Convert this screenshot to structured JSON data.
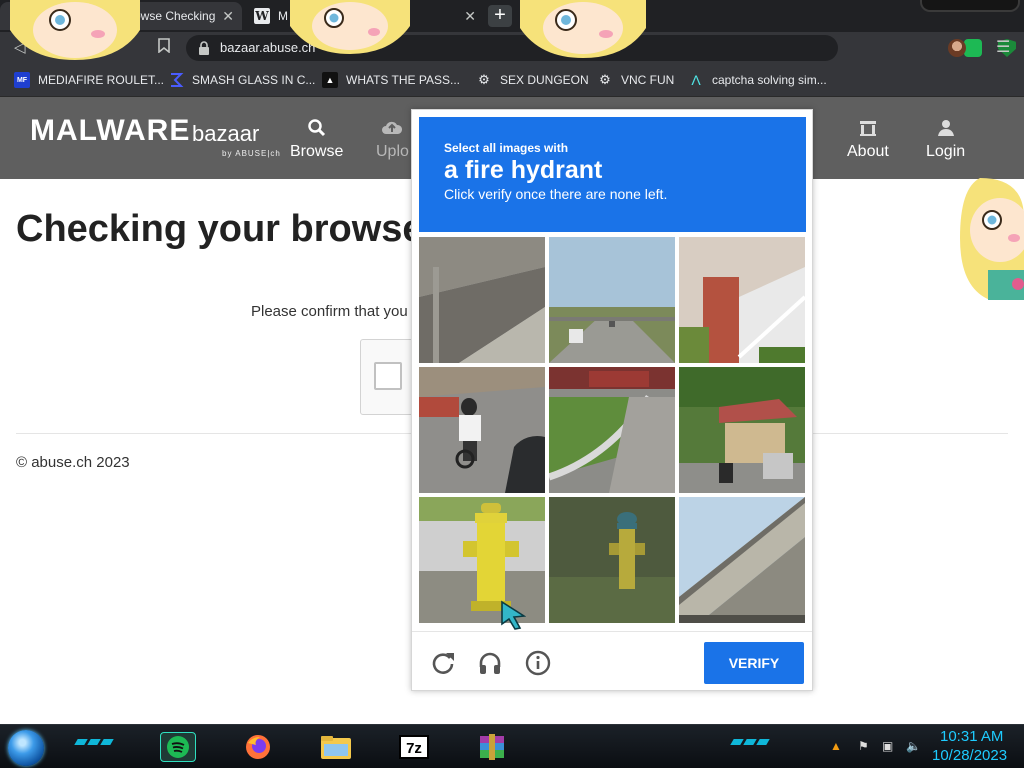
{
  "browser": {
    "tabs": [
      {
        "title": "owse Checking",
        "active": true
      },
      {
        "title": "M",
        "active": false,
        "favicon": "W"
      }
    ],
    "address": {
      "url": "bazaar.abuse.ch"
    },
    "bookmarks": [
      {
        "label": "MEDIAFIRE ROULET...",
        "icon": "MF"
      },
      {
        "label": "SMASH GLASS IN C...",
        "icon": "sigma"
      },
      {
        "label": "WHATS THE PASS...",
        "icon": "dark"
      },
      {
        "label": "SEX DUNGEON",
        "icon": "gear"
      },
      {
        "label": "VNC FUN",
        "icon": "gear"
      },
      {
        "label": "captcha solving sim...",
        "icon": "lambda"
      }
    ]
  },
  "site": {
    "logo_main": "MALWARE",
    "logo_sub": "bazaar",
    "logo_by": "by ABUSE|ch",
    "nav": [
      {
        "label": "Browse"
      },
      {
        "label": "Uplo"
      },
      {
        "label": "About"
      },
      {
        "label": "Login"
      }
    ],
    "page_title": "Checking your browse",
    "confirm_text": "Please confirm that you",
    "footer": "© abuse.ch 2023"
  },
  "captcha": {
    "select_text": "Select all images with",
    "target": "a fire hydrant",
    "instruction": "Click verify once there are none left.",
    "verify_label": "VERIFY",
    "tiles": [
      "overpass-underside",
      "highway-overpass",
      "house-steps",
      "cyclist-road",
      "guardrail-grass",
      "street-houses",
      "yellow-hydrant",
      "green-yellow-hydrant",
      "bridge-underside"
    ]
  },
  "taskbar": {
    "time": "10:31 AM",
    "date": "10/28/2023",
    "apps": [
      "spotify",
      "firefox",
      "file-explorer",
      "7zip",
      "winrar"
    ]
  },
  "colors": {
    "captcha_blue": "#1a73e8",
    "clock_cyan": "#1ecbff",
    "header_gray": "#5f5f5f"
  }
}
